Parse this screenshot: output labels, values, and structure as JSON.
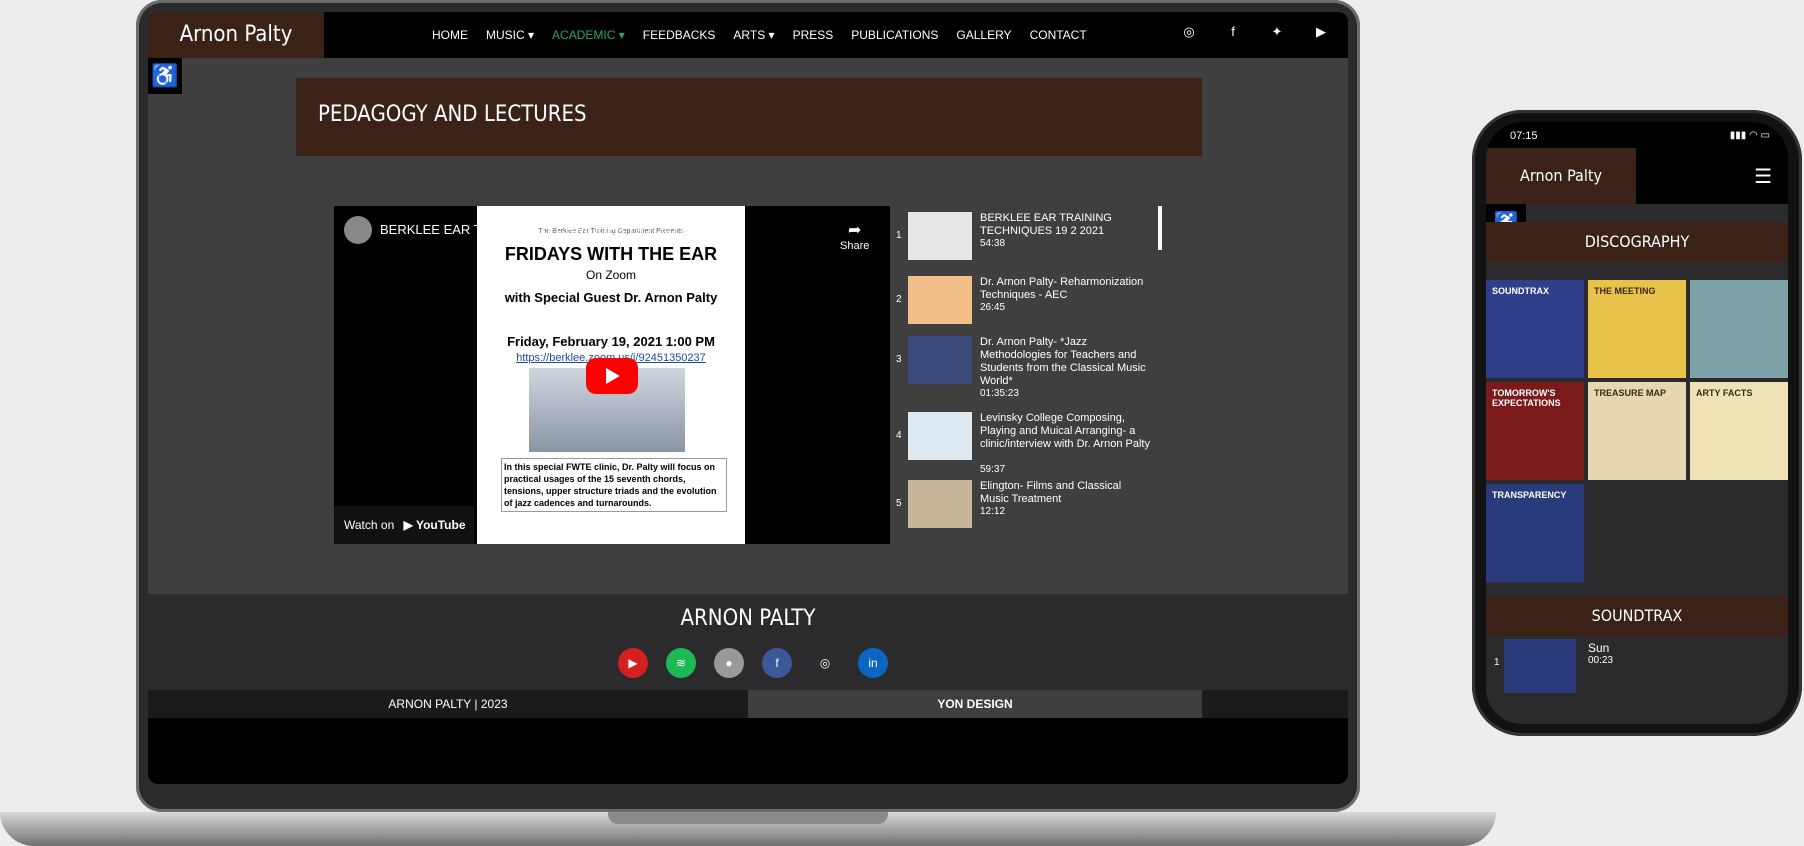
{
  "laptop": {
    "brand": "Arnon Palty",
    "menu": [
      {
        "label": "HOME",
        "active": false,
        "caret": false
      },
      {
        "label": "MUSIC",
        "active": false,
        "caret": true
      },
      {
        "label": "ACADEMIC",
        "active": true,
        "caret": true
      },
      {
        "label": "FEEDBACKS",
        "active": false,
        "caret": false
      },
      {
        "label": "ARTS",
        "active": false,
        "caret": true
      },
      {
        "label": "PRESS",
        "active": false,
        "caret": false
      },
      {
        "label": "PUBLICATIONS",
        "active": false,
        "caret": false
      },
      {
        "label": "GALLERY",
        "active": false,
        "caret": false
      },
      {
        "label": "CONTACT",
        "active": false,
        "caret": false
      }
    ],
    "page_title": "PEDAGOGY AND LECTURES",
    "video": {
      "title": "BERKLEE EAR TRAINING TECHNIQUES 19 2 2021",
      "share": "Share",
      "watch_on": "Watch on",
      "youtube": "YouTube",
      "poster_header": "The Berklee Ear Training Department Presents",
      "poster_line1": "FRIDAYS WITH THE EAR",
      "poster_line2": "On Zoom",
      "poster_line3": "with Special Guest Dr. Arnon Palty",
      "poster_date": "Friday, February 19, 2021 1:00 PM",
      "poster_link": "https://berklee.zoom.us/j/92451350237",
      "poster_desc": "In this special FWTE clinic, Dr. Palty will focus on practical usages of the 15 seventh chords, tensions, upper structure triads and the evolution of jazz cadences and turnarounds."
    },
    "playlist": [
      {
        "num": "1",
        "title": "BERKLEE EAR TRAINING TECHNIQUES 19 2 2021",
        "duration": "54:38"
      },
      {
        "num": "2",
        "title": "Dr. Arnon Palty- Reharmonization Techniques - AEC",
        "duration": "26:45"
      },
      {
        "num": "3",
        "title": "Dr. Arnon Palty- *Jazz Methodologies for Teachers and Students from the Classical Music World*",
        "duration": "01:35:23"
      },
      {
        "num": "4",
        "title": "Levinsky College Composing, Playing and Muical Arranging- a clinic/interview with Dr. Arnon Palty",
        "duration": "59:37"
      },
      {
        "num": "5",
        "title": "Elington- Films and Classical Music Treatment",
        "duration": "12:12"
      }
    ],
    "footer": {
      "name": "ARNON PALTY",
      "copyright": "ARNON PALTY | 2023",
      "design": "YON DESIGN"
    },
    "colors": {
      "brand_brown": "#3b2217",
      "accent_green": "#2ea36a",
      "panel_gray": "#3f3f40"
    }
  },
  "phone": {
    "time": "07:15",
    "brand": "Arnon Palty",
    "discography_title": "DISCOGRAPHY",
    "albums": [
      {
        "title": "SOUNDTRAX",
        "color": "#2f3f8a"
      },
      {
        "title": "THE MEETING",
        "color": "#e9c24a"
      },
      {
        "title": "",
        "color": "#7da3a8"
      },
      {
        "title": "TOMORROW'S EXPECTATIONS",
        "color": "#7a1a1a"
      },
      {
        "title": "TREASURE MAP",
        "color": "#e7d7b0"
      },
      {
        "title": "ARTY FACTS",
        "color": "#efe2b6"
      },
      {
        "title": "TRANSPARENCY",
        "color": "#2a3b7c"
      }
    ],
    "soundtrax_title": "SOUNDTRAX",
    "track": {
      "num": "1",
      "name": "Sun",
      "duration": "00:23"
    }
  }
}
